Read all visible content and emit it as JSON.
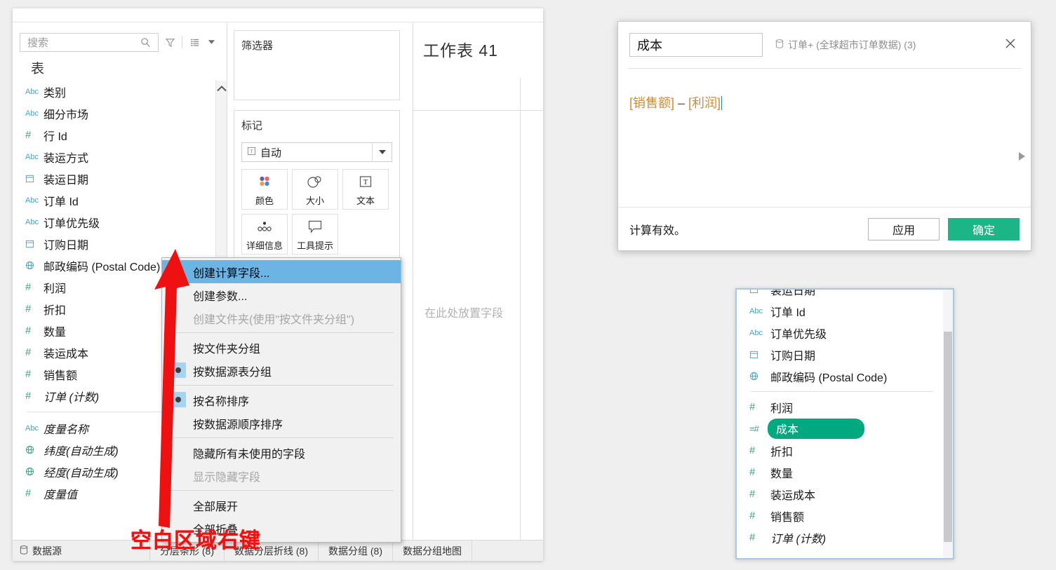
{
  "app": {
    "background": "#efefef",
    "accent_green": "#1cb585",
    "pill_green": "#00a97f",
    "select_blue": "#6cb4e4",
    "annotation_red": "#ee1111"
  },
  "data_pane": {
    "search": {
      "placeholder": "搜索",
      "value": ""
    },
    "icons": {
      "search": "search-icon",
      "filter": "filter-icon",
      "grid": "grid-view-icon",
      "caret": "chevron-down-icon"
    },
    "table_header": "表",
    "fields": [
      {
        "label": "类别",
        "type": "Abc",
        "italic": false
      },
      {
        "label": "细分市场",
        "type": "Abc",
        "italic": false
      },
      {
        "label": "行 Id",
        "type": "#",
        "italic": false
      },
      {
        "label": "装运方式",
        "type": "Abc",
        "italic": false
      },
      {
        "label": "装运日期",
        "type": "date",
        "italic": false
      },
      {
        "label": "订单 Id",
        "type": "Abc",
        "italic": false
      },
      {
        "label": "订单优先级",
        "type": "Abc",
        "italic": false
      },
      {
        "label": "订购日期",
        "type": "date",
        "italic": false
      },
      {
        "label": "邮政编码 (Postal Code)",
        "type": "geo",
        "italic": false
      },
      {
        "label": "利润",
        "type": "#",
        "italic": false
      },
      {
        "label": "折扣",
        "type": "#",
        "italic": false
      },
      {
        "label": "数量",
        "type": "#",
        "italic": false
      },
      {
        "label": "装运成本",
        "type": "#",
        "italic": false
      },
      {
        "label": "销售额",
        "type": "#",
        "italic": false
      },
      {
        "label": "订单 (计数)",
        "type": "#",
        "italic": true
      }
    ],
    "generated_fields": [
      {
        "label": "度量名称",
        "type": "Abc",
        "italic": true
      },
      {
        "label": "纬度(自动生成)",
        "type": "geo-m",
        "italic": true
      },
      {
        "label": "经度(自动生成)",
        "type": "geo-m",
        "italic": true
      },
      {
        "label": "度量值",
        "type": "#",
        "italic": true
      }
    ]
  },
  "shelf": {
    "filters_title": "筛选器",
    "marks_title": "标记",
    "mark_type": "自动",
    "mark_type_icon": "automatic-mark-icon",
    "mark_buttons": [
      {
        "label": "颜色",
        "icon": "color-icon"
      },
      {
        "label": "大小",
        "icon": "size-icon"
      },
      {
        "label": "文本",
        "icon": "text-icon"
      },
      {
        "label": "详细信息",
        "icon": "detail-icon"
      },
      {
        "label": "工具提示",
        "icon": "tooltip-icon"
      }
    ]
  },
  "sheet": {
    "title": "工作表 41",
    "drop_zone": "在此处放置字段"
  },
  "statusbar": {
    "data_source": "数据源",
    "data_source_icon": "database-icon",
    "tabs": [
      "分层条形 (8)",
      "数据分层折线 (8)",
      "数据分组 (8)",
      "数据分组地图"
    ]
  },
  "context_menu": {
    "items": [
      {
        "label": "创建计算字段...",
        "state": "selected",
        "radio": false
      },
      {
        "label": "创建参数...",
        "state": "normal",
        "radio": false
      },
      {
        "label": "创建文件夹(使用\"按文件夹分组\")",
        "state": "disabled",
        "radio": false
      },
      {
        "separator": true
      },
      {
        "label": "按文件夹分组",
        "state": "normal",
        "radio": false
      },
      {
        "label": "按数据源表分组",
        "state": "normal",
        "radio": true
      },
      {
        "separator": true
      },
      {
        "label": "按名称排序",
        "state": "normal",
        "radio": true
      },
      {
        "label": "按数据源顺序排序",
        "state": "normal",
        "radio": false
      },
      {
        "separator": true
      },
      {
        "label": "隐藏所有未使用的字段",
        "state": "normal",
        "radio": false
      },
      {
        "label": "显示隐藏字段",
        "state": "disabled",
        "radio": false
      },
      {
        "separator": true
      },
      {
        "label": "全部展开",
        "state": "normal",
        "radio": false
      },
      {
        "label": "全部折叠",
        "state": "normal",
        "radio": false
      }
    ]
  },
  "annotation": {
    "text": "空白区域右键",
    "arrow": "red-arrow-icon"
  },
  "calc_dialog": {
    "name_value": "成本",
    "name_placeholder": "",
    "source_label": "订单+ (全球超市订单数据) (3)",
    "source_icon": "database-icon",
    "close_icon": "close-icon",
    "formula_tokens": [
      {
        "text": "[销售额]",
        "kind": "field"
      },
      {
        "text": " – ",
        "kind": "op"
      },
      {
        "text": "[利润]",
        "kind": "field"
      }
    ],
    "formula_plain": "[销售额] – [利润]",
    "status": "计算有效。",
    "apply_label": "应用",
    "ok_label": "确定"
  },
  "result_panel": {
    "fields": [
      {
        "label": "装运日期",
        "type": "date",
        "italic": false,
        "highlight": false
      },
      {
        "label": "订单 Id",
        "type": "Abc",
        "italic": false,
        "highlight": false
      },
      {
        "label": "订单优先级",
        "type": "Abc",
        "italic": false,
        "highlight": false
      },
      {
        "label": "订购日期",
        "type": "date",
        "italic": false,
        "highlight": false
      },
      {
        "label": "邮政编码 (Postal Code)",
        "type": "geo",
        "italic": false,
        "highlight": false
      },
      {
        "divider": true
      },
      {
        "label": "利润",
        "type": "#",
        "italic": false,
        "highlight": false
      },
      {
        "label": "成本",
        "type": "calc",
        "italic": false,
        "highlight": true
      },
      {
        "label": "折扣",
        "type": "#",
        "italic": false,
        "highlight": false
      },
      {
        "label": "数量",
        "type": "#",
        "italic": false,
        "highlight": false
      },
      {
        "label": "装运成本",
        "type": "#",
        "italic": false,
        "highlight": false
      },
      {
        "label": "销售额",
        "type": "#",
        "italic": false,
        "highlight": false
      },
      {
        "label": "订单 (计数)",
        "type": "#",
        "italic": true,
        "highlight": false
      }
    ]
  }
}
